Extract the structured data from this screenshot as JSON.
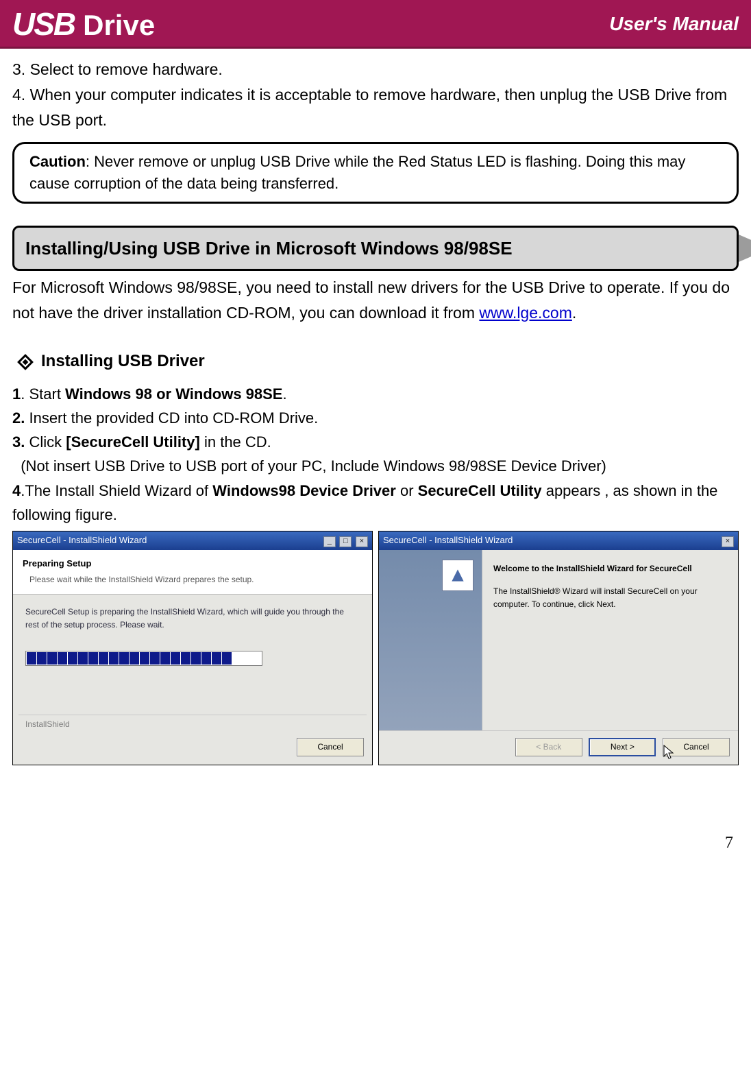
{
  "header": {
    "logo_usb": "USB",
    "logo_drive": "Drive",
    "manual": "User's Manual"
  },
  "body": {
    "step3": "3. Select to remove hardware.",
    "step4": "4. When your computer indicates it is acceptable to remove hardware, then unplug the USB Drive from the USB port.",
    "caution_label": "Caution",
    "caution_text": ": Never remove or unplug USB Drive while the Red Status LED is flashing. Doing this may cause corruption of the data being transferred.",
    "section_title": "Installing/Using USB Drive in Microsoft Windows 98/98SE",
    "section_intro_a": "For Microsoft Windows 98/98SE, you need to install new drivers for the USB Drive to operate. If you do not have the driver installation CD-ROM, you can download it from ",
    "section_link": "www.lge.com",
    "section_intro_b": ".",
    "bullet_title": "Installing USB Driver",
    "s1_a": "1",
    "s1_b": ". Start ",
    "s1_c": "Windows 98 or Windows 98SE",
    "s1_d": ".",
    "s2_a": "2.",
    "s2_b": " Insert the provided CD into CD-ROM Drive.",
    "s3_a": "3.",
    "s3_b": " Click ",
    "s3_c": "[SecureCell Utility]",
    "s3_d": " in the CD.",
    "s3_note": "  (Not insert USB Drive to USB port of your PC, Include Windows 98/98SE Device Driver)",
    "s4_a": "4",
    "s4_b": ".The Install Shield Wizard of ",
    "s4_c": "Windows98 Device Driver",
    "s4_d": " or ",
    "s4_e": "SecureCell Utility",
    "s4_f": " appears , as shown in the following figure."
  },
  "dialog1": {
    "title": "SecureCell - InstallShield Wizard",
    "heading": "Preparing Setup",
    "sub": "Please wait while the InstallShield Wizard prepares the setup.",
    "body": "SecureCell Setup is preparing the InstallShield Wizard, which will guide you through the rest of the setup process. Please wait.",
    "footer_label": "InstallShield",
    "cancel": "Cancel"
  },
  "dialog2": {
    "title": "SecureCell - InstallShield Wizard",
    "welcome": "Welcome to the InstallShield Wizard for SecureCell",
    "body": "The InstallShield® Wizard will install SecureCell on your computer.  To continue, click Next.",
    "back": "< Back",
    "next": "Next >",
    "cancel": "Cancel"
  },
  "page_number": "7"
}
